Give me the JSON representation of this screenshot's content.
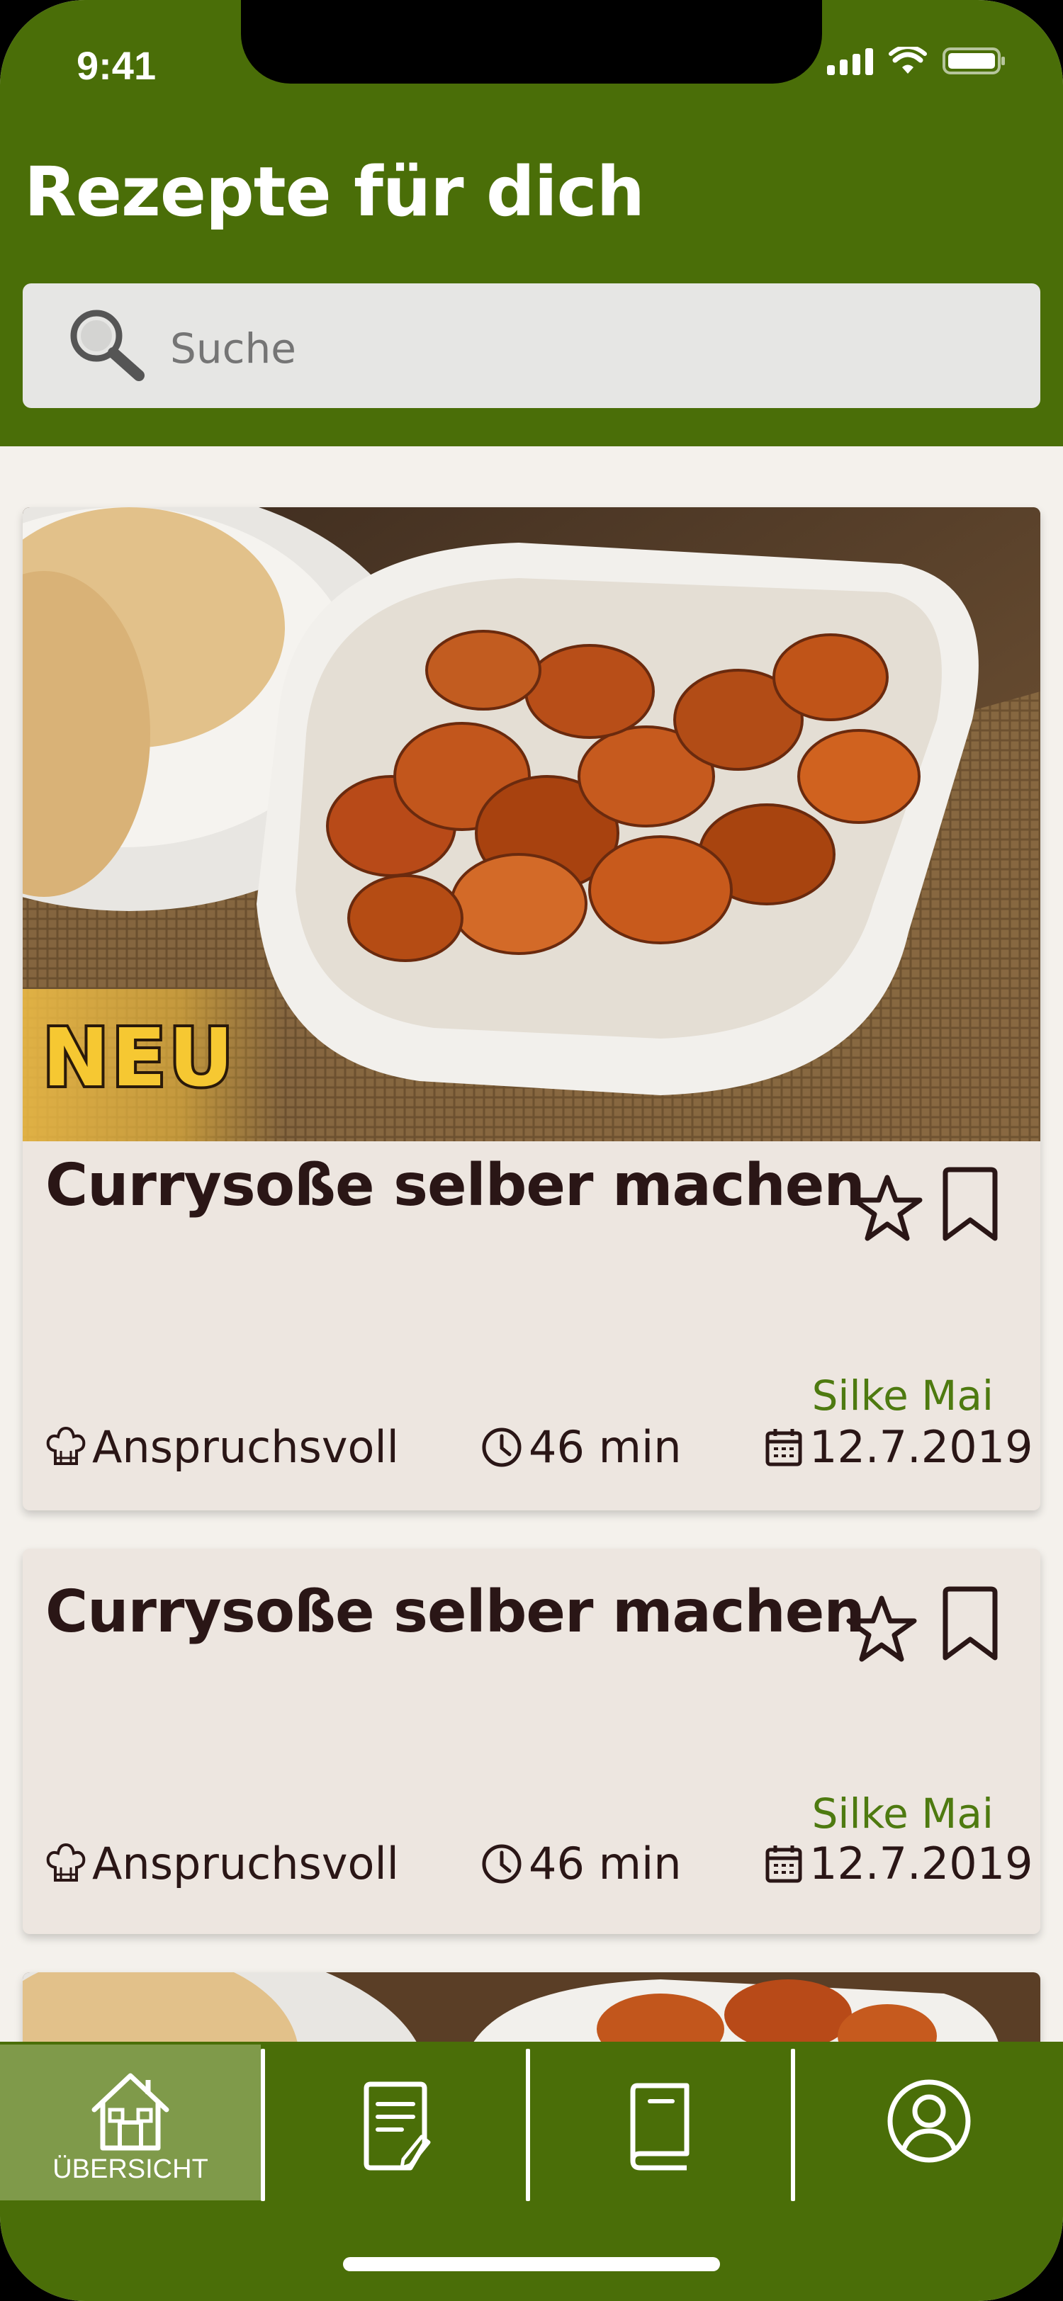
{
  "status_bar": {
    "time": "9:41"
  },
  "header": {
    "title": "Rezepte für dich"
  },
  "search": {
    "placeholder": "Suche"
  },
  "cards": [
    {
      "badge": "NEU",
      "title": "Currysoße selber machen",
      "author": "Silke Mai",
      "difficulty": "Anspruchsvoll",
      "duration": "46 min",
      "date": "12.7.2019"
    },
    {
      "title": "Currysoße selber machen",
      "author": "Silke Mai",
      "difficulty": "Anspruchsvoll",
      "duration": "46 min",
      "date": "12.7.2019"
    }
  ],
  "tabbar": {
    "tabs": [
      {
        "label": "ÜBERSICHT",
        "icon": "home-icon",
        "active": true
      },
      {
        "label": "",
        "icon": "recipe-note-icon",
        "active": false
      },
      {
        "label": "",
        "icon": "cookbook-icon",
        "active": false
      },
      {
        "label": "",
        "icon": "profile-icon",
        "active": false
      }
    ]
  },
  "colors": {
    "brand_green": "#4a6e08",
    "active_tab": "#7f9a4a",
    "card_bg": "#ede6e0",
    "author_green": "#4e7a10",
    "text_dark": "#2a1616"
  }
}
